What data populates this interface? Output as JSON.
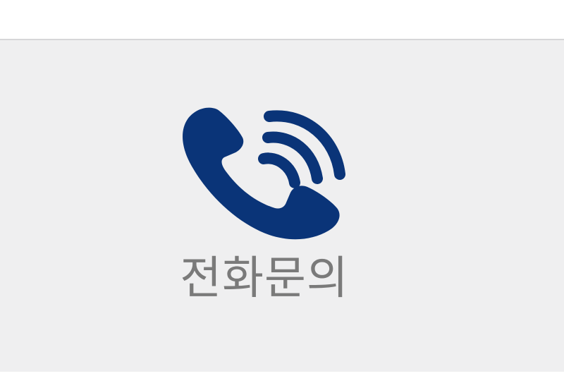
{
  "contact": {
    "label": "전화문의",
    "icon": "phone-call-icon",
    "icon_color": "#0a3478",
    "label_color": "#7a7a7a",
    "panel_color": "#efeff0"
  }
}
